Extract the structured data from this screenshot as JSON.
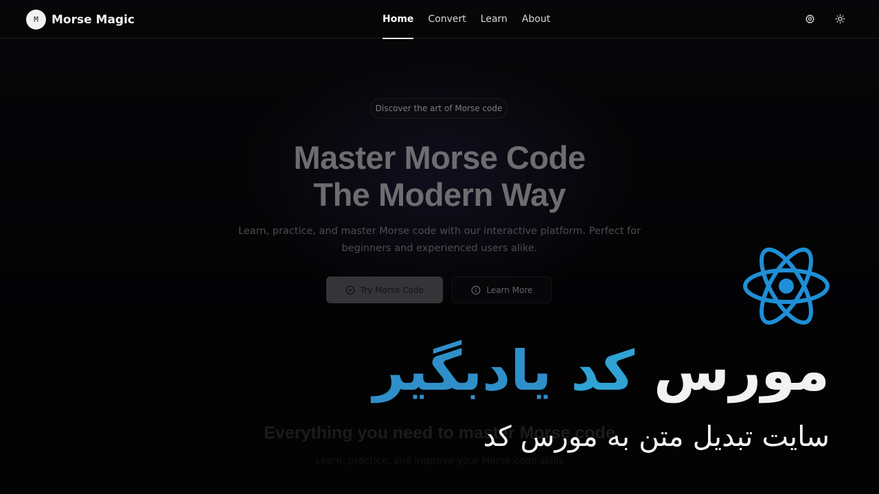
{
  "brand": {
    "logo_letter": "M",
    "name": "Morse Magic"
  },
  "nav": {
    "items": [
      {
        "label": "Home",
        "active": true
      },
      {
        "label": "Convert",
        "active": false
      },
      {
        "label": "Learn",
        "active": false
      },
      {
        "label": "About",
        "active": false
      }
    ],
    "icons": [
      "gear-icon",
      "sun-icon"
    ]
  },
  "hero": {
    "pill": "Discover the art of Morse code",
    "headline_line1": "Master Morse Code",
    "headline_line2": "The Modern Way",
    "description": "Learn, practice, and master Morse code with our interactive platform. Perfect for beginners and experienced users alike.",
    "primary_button": "Try Morse Code",
    "secondary_button": "Learn More"
  },
  "features": {
    "title": "Everything you need to master Morse code",
    "subtitle": "Learn, practice, and improve your Morse code skills"
  },
  "overlay": {
    "title_word1": "مورس",
    "title_word2": "کد",
    "title_word3": "یادبگیر",
    "subtitle": "سایت تبدیل متن به مورس کد",
    "logo": "react-icon"
  },
  "colors": {
    "background": "#050507",
    "accent_blue": "#2fa3d4"
  }
}
